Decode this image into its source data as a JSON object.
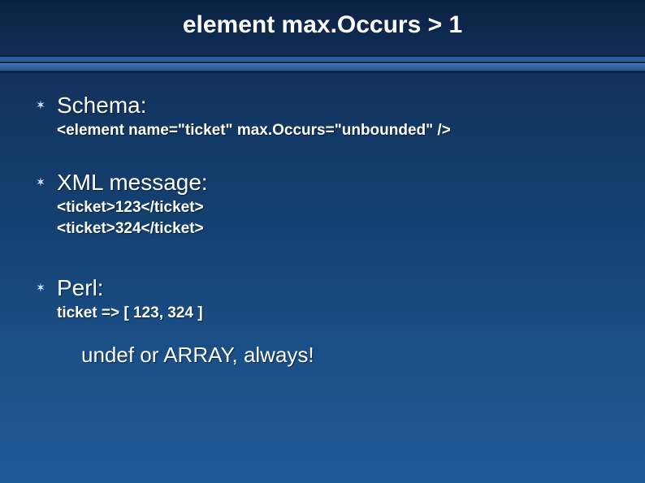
{
  "title": "element max.Occurs > 1",
  "sections": [
    {
      "heading": "Schema:",
      "code": [
        "<element name=\"ticket\" max.Occurs=\"unbounded\" />"
      ]
    },
    {
      "heading": "XML message:",
      "code": [
        "<ticket>123</ticket>",
        "<ticket>324</ticket>"
      ]
    },
    {
      "heading": "Perl:",
      "code": [
        "ticket => [ 123, 324 ]"
      ]
    }
  ],
  "final": "undef or ARRAY, always!"
}
